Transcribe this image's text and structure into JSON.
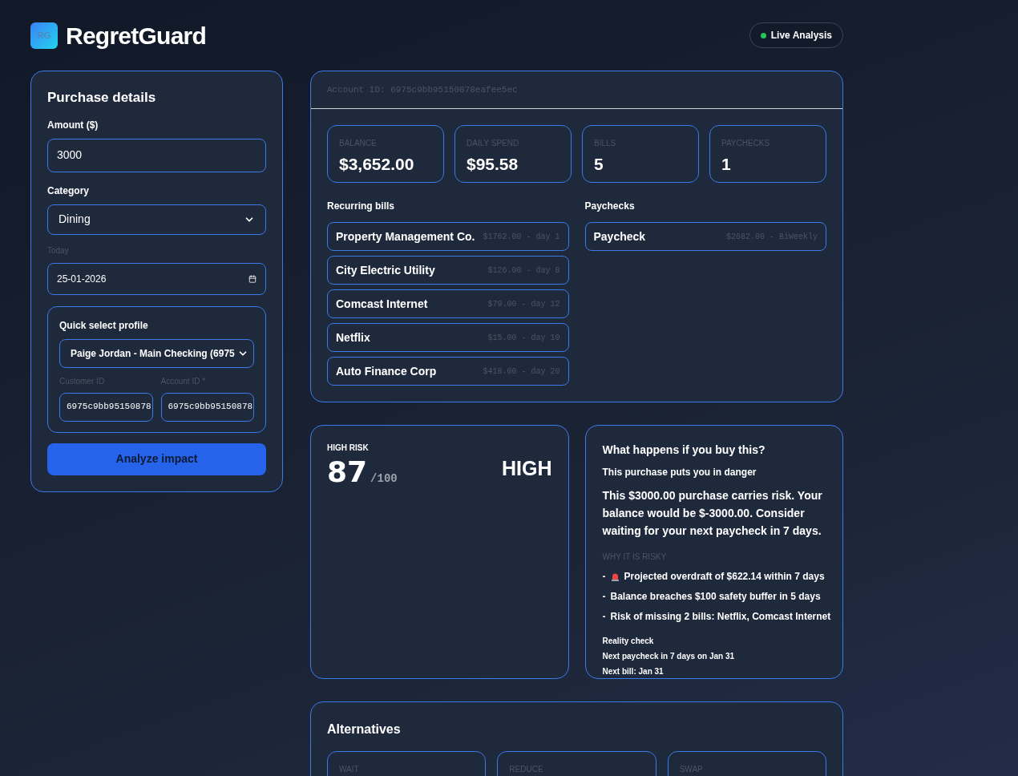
{
  "brand": {
    "logo": "RG",
    "name": "RegretGuard"
  },
  "status_pill": {
    "label": "Live Analysis",
    "color": "#22c55e"
  },
  "purchase": {
    "title": "Purchase details",
    "amount_label": "Amount ($)",
    "amount": "3000",
    "category_label": "Category",
    "category": "Dining",
    "date_label": "Today",
    "date": "25-01-2026",
    "profile": {
      "title": "Quick select profile",
      "selected": "Paige Jordan - Main Checking (6975",
      "customer_id_label": "Customer ID",
      "customer_id": "6975c9bb95150878",
      "account_id_label": "Account ID *",
      "account_id": "6975c9bb95150878"
    },
    "button": "Analyze impact"
  },
  "account": {
    "id_line": "Account ID: 6975c9bb95150878eafee5ec",
    "stats": [
      {
        "label": "BALANCE",
        "value": "$3,652.00"
      },
      {
        "label": "DAILY SPEND",
        "value": "$95.58"
      },
      {
        "label": "BILLS",
        "value": "5"
      },
      {
        "label": "PAYCHECKS",
        "value": "1"
      }
    ],
    "bills_title": "Recurring bills",
    "bills": [
      {
        "name": "Property Management Co.",
        "detail": "$1762.00 - day 1"
      },
      {
        "name": "City Electric Utility",
        "detail": "$126.00 - day 8"
      },
      {
        "name": "Comcast Internet",
        "detail": "$79.00 - day 12"
      },
      {
        "name": "Netflix",
        "detail": "$15.00 - day 10"
      },
      {
        "name": "Auto Finance Corp",
        "detail": "$418.00 - day 20"
      }
    ],
    "paychecks_title": "Paychecks",
    "paychecks": [
      {
        "name": "Paycheck",
        "detail": "$2682.00 - BiWeekly"
      }
    ]
  },
  "risk": {
    "label": "HIGH RISK",
    "score": "87",
    "max": "/100",
    "level": "HIGH"
  },
  "outcome": {
    "title": "What happens if you buy this?",
    "subtitle": "This purchase puts you in danger",
    "summary": "This $3000.00 purchase carries risk. Your balance would be $-3000.00. Consider waiting for your next paycheck in 7 days.",
    "reasons_title": "WHY IT IS RISKY",
    "reasons": [
      {
        "kind": "alert",
        "marker": "-",
        "text": "Projected overdraft of $622.14 within 7 days"
      },
      {
        "kind": "plain",
        "marker": "-",
        "text": "Balance breaches $100 safety buffer in 5 days"
      },
      {
        "kind": "plain",
        "marker": "-",
        "text": "Risk of missing 2 bills: Netflix, Comcast Internet"
      }
    ],
    "reality_title": "Reality check",
    "reality": [
      "Next paycheck in 7 days on Jan 31",
      "Next bill: Jan 31"
    ]
  },
  "alternatives": {
    "title": "Alternatives",
    "items": [
      {
        "label": "WAIT"
      },
      {
        "label": "REDUCE"
      },
      {
        "label": "SWAP"
      }
    ]
  }
}
